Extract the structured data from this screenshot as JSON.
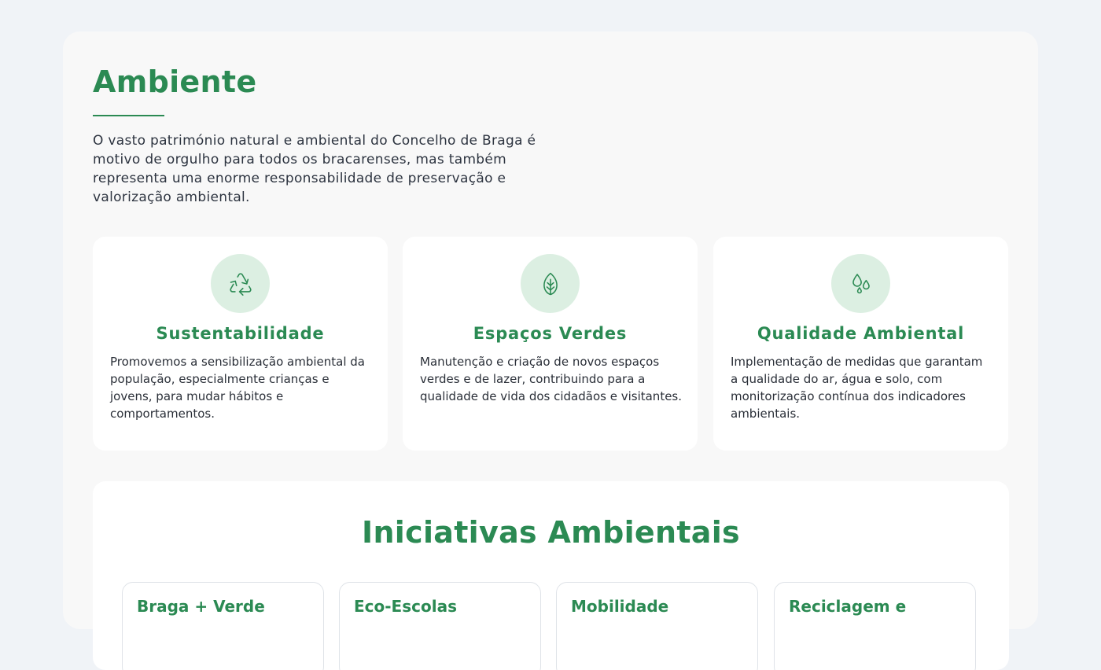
{
  "section": {
    "title": "Ambiente",
    "intro": "O vasto património natural e ambiental do Concelho de Braga é motivo de orgulho para todos os bracarenses, mas também representa uma enorme responsabilidade de preservação e valorização ambiental."
  },
  "cards": [
    {
      "icon": "recycle-icon",
      "title": "Sustentabilidade",
      "text": "Promovemos a sensibilização ambiental da população, especialmente crianças e jovens, para mudar hábitos e comportamentos."
    },
    {
      "icon": "leaf-icon",
      "title": "Espaços Verdes",
      "text": "Manutenção e criação de novos espaços verdes e de lazer, contribuindo para a qualidade de vida dos cidadãos e visitantes."
    },
    {
      "icon": "water-drops-icon",
      "title": "Qualidade Ambiental",
      "text": "Implementação de medidas que garantam a qualidade do ar, água e solo, com monitorização contínua dos indicadores ambientais."
    }
  ],
  "initiatives": {
    "title": "Iniciativas Ambientais",
    "items": [
      {
        "title": "Braga + Verde"
      },
      {
        "title": "Eco-Escolas"
      },
      {
        "title": "Mobilidade"
      },
      {
        "title": "Reciclagem e"
      }
    ]
  },
  "colors": {
    "accent": "#2b8a53",
    "icon_bg": "#dcefe2",
    "page_bg": "#f0f3f7",
    "panel_bg": "#f8f8f8",
    "text": "#2d3440"
  }
}
